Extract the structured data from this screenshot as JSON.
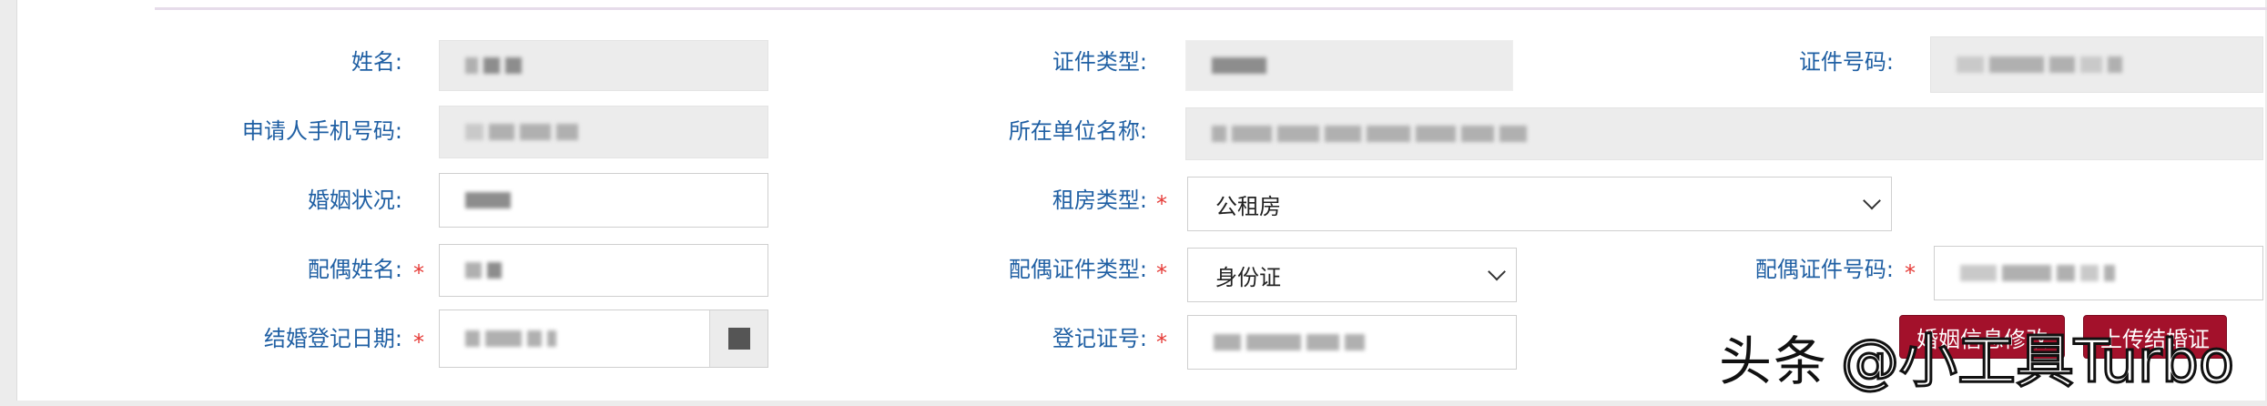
{
  "form": {
    "name_label": "姓名:",
    "id_type_label": "证件类型:",
    "id_number_label": "证件号码:",
    "phone_label": "申请人手机号码:",
    "employer_label": "所在单位名称:",
    "marital_label": "婚姻状况:",
    "rental_type_label": "租房类型:",
    "rental_type_value": "公租房",
    "spouse_name_label": "配偶姓名:",
    "spouse_id_type_label": "配偶证件类型:",
    "spouse_id_type_value": "身份证",
    "spouse_id_number_label": "配偶证件号码:",
    "marriage_date_label": "结婚登记日期:",
    "marriage_cert_label": "登记证号:",
    "required_mark": "*"
  },
  "buttons": {
    "edit_marriage": "婚姻信息修改",
    "upload_marriage_cert": "上传结婚证"
  },
  "watermark": {
    "logo": "头条",
    "handle": "@小工具Turbo"
  },
  "colors": {
    "label": "#1f5fa3",
    "required": "#e53935",
    "button": "#a3112b"
  }
}
